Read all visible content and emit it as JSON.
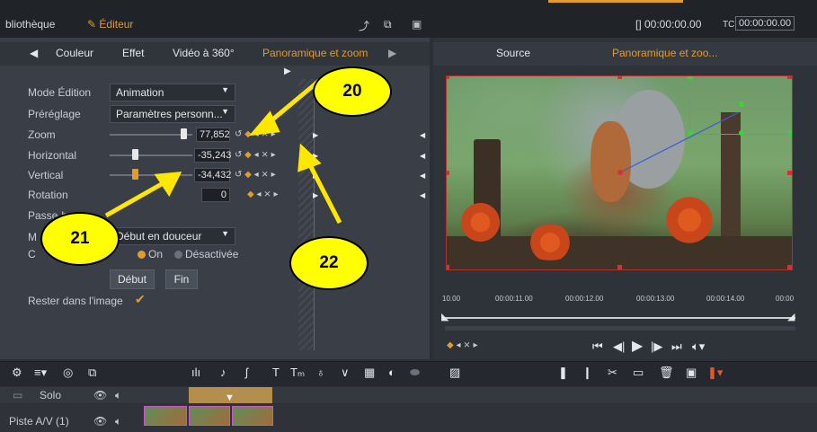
{
  "topbar": {
    "library_label": "bliothèque",
    "editor_label": "Éditeur",
    "timecode_main": "[] 00:00:00.00",
    "tc_label": "TC",
    "tc_value": "00:00:00.00"
  },
  "effect_tabs": [
    {
      "label": "Couleur"
    },
    {
      "label": "Effet"
    },
    {
      "label": "Vidéo à 360°"
    },
    {
      "label": "Panoramique et zoom"
    }
  ],
  "preview_tabs": {
    "source": "Source",
    "panzoom": "Panoramique et zoo..."
  },
  "properties": {
    "mode_label": "Mode Édition",
    "mode_value": "Animation",
    "preset_label": "Préréglage",
    "preset_value": "Paramètres personn...",
    "zoom_label": "Zoom",
    "zoom_value": "77,852",
    "horizontal_label": "Horizontal",
    "horizontal_value": "-35,243",
    "vertical_label": "Vertical",
    "vertical_value": "-34,432",
    "rotation_label": "Rotation",
    "rotation_value": "0",
    "passe_label": "Passe-b",
    "m_label": "M",
    "transition_value": "Début en douceur",
    "c_label": "C",
    "radio_on": "On",
    "radio_off": "Désactivée",
    "start_button": "Début",
    "end_button": "Fin",
    "stay_label": "Rester dans l'image"
  },
  "ruler_labels": [
    "10.00",
    "00:00:11.00",
    "00:00:12.00",
    "00:00:13.00",
    "00:00:14.00",
    "00:00"
  ],
  "tracks": {
    "solo_label": "Solo",
    "av_label": "Piste A/V (1)"
  },
  "callouts": [
    "20",
    "21",
    "22"
  ],
  "colors": {
    "accent": "#e39b2a",
    "callout": "#ffff00"
  }
}
